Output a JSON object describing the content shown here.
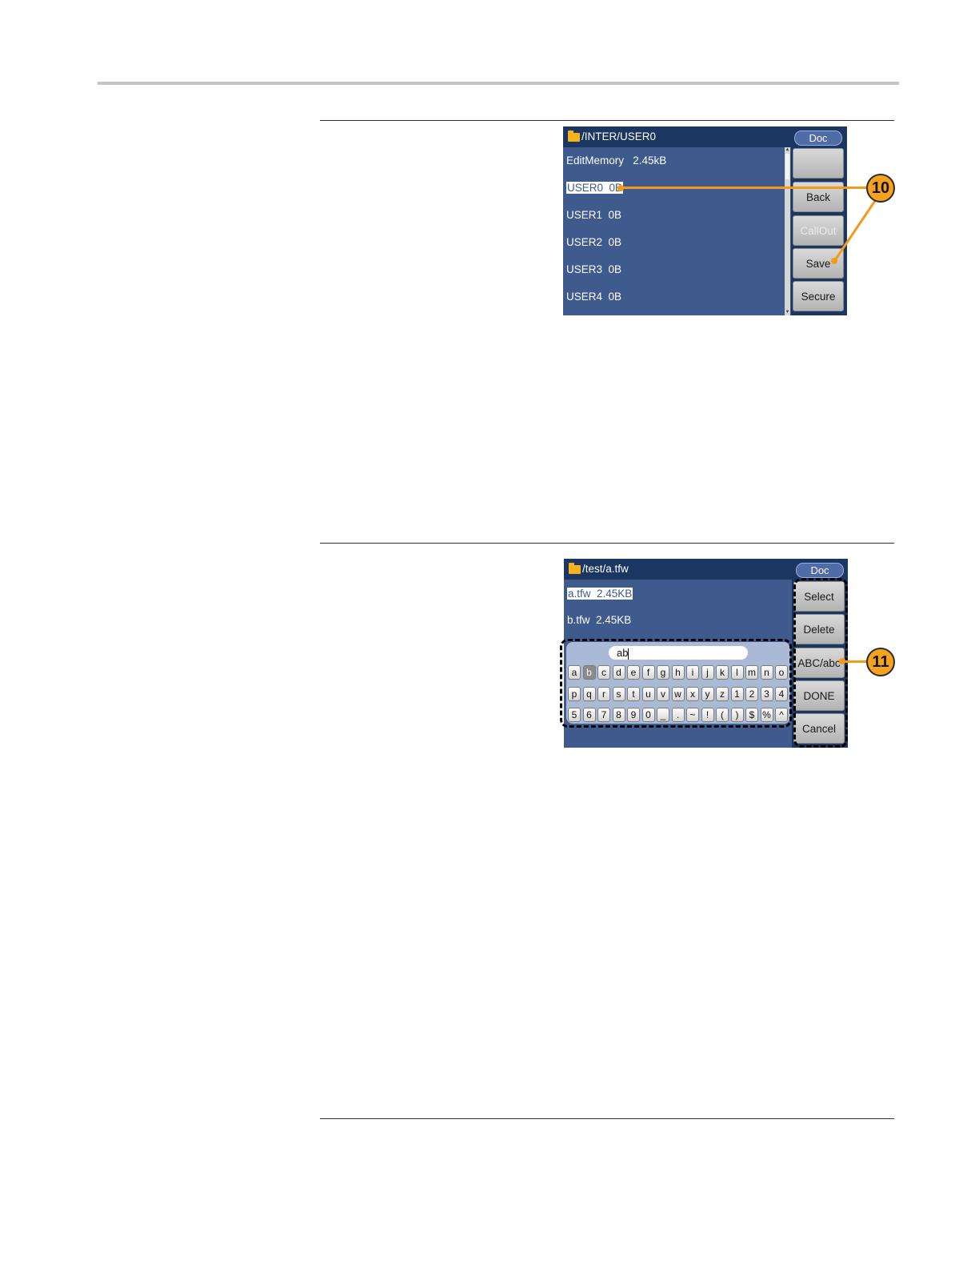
{
  "screen1": {
    "path": "/INTER/USER0",
    "doc_label": "Doc",
    "files": [
      {
        "name": "EditMemory   2.45kB",
        "selected": false
      },
      {
        "name": "USER0  0B",
        "selected": true
      },
      {
        "name": "USER1  0B",
        "selected": false
      },
      {
        "name": "USER2  0B",
        "selected": false
      },
      {
        "name": "USER3  0B",
        "selected": false
      },
      {
        "name": "USER4  0B",
        "selected": false
      }
    ],
    "softkeys": [
      "",
      "Back",
      "CallOut",
      "Save",
      "Secure"
    ],
    "callout": "10"
  },
  "screen2": {
    "path": "/test/a.tfw",
    "doc_label": "Doc",
    "files": [
      {
        "name": "a.tfw  2.45KB",
        "selected": true
      },
      {
        "name": "b.tfw  2.45KB",
        "selected": false
      }
    ],
    "keyboard": {
      "input_value": "ab",
      "active_key": "b",
      "rows": [
        [
          "a",
          "b",
          "c",
          "d",
          "e",
          "f",
          "g",
          "h",
          "i",
          "j",
          "k",
          "l",
          "m",
          "n",
          "o"
        ],
        [
          "p",
          "q",
          "r",
          "s",
          "t",
          "u",
          "v",
          "w",
          "x",
          "y",
          "z",
          "1",
          "2",
          "3",
          "4"
        ],
        [
          "5",
          "6",
          "7",
          "8",
          "9",
          "0",
          "_",
          ".",
          "~",
          "!",
          "(",
          ")",
          "$",
          "%",
          "^"
        ]
      ]
    },
    "softkeys": [
      "Select",
      "Delete",
      "ABC/abc",
      "DONE",
      "Cancel"
    ],
    "callout": "11"
  },
  "colors": {
    "screen_bg": "#3f5a8c",
    "titlebar": "#1c3662",
    "callout": "#f39a1b"
  },
  "icons": [
    "folder-icon",
    "scroll-up-arrow-icon",
    "scroll-down-arrow-icon"
  ]
}
